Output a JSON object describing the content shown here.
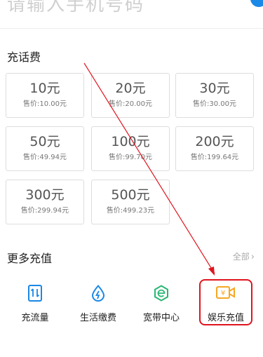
{
  "phone_input": {
    "placeholder": "请输入手机号码"
  },
  "recharge": {
    "title": "充话费",
    "options": [
      {
        "amount": "10元",
        "price": "售价:10.00元"
      },
      {
        "amount": "20元",
        "price": "售价:20.00元"
      },
      {
        "amount": "30元",
        "price": "售价:30.00元"
      },
      {
        "amount": "50元",
        "price": "售价:49.94元"
      },
      {
        "amount": "100元",
        "price": "售价:99.70元"
      },
      {
        "amount": "200元",
        "price": "售价:199.64元"
      },
      {
        "amount": "300元",
        "price": "售价:299.94元"
      },
      {
        "amount": "500元",
        "price": "售价:499.23元"
      }
    ]
  },
  "more": {
    "title": "更多充值",
    "all_label": "全部",
    "items": [
      {
        "label": "充流量",
        "icon": "data-traffic-icon"
      },
      {
        "label": "生活缴费",
        "icon": "bill-payment-icon"
      },
      {
        "label": "宽带中心",
        "icon": "broadband-icon"
      },
      {
        "label": "娱乐充值",
        "icon": "entertainment-recharge-icon"
      }
    ]
  },
  "colors": {
    "accent_blue": "#1a88e6",
    "accent_green": "#2bb673",
    "accent_orange": "#f5a623",
    "annotation_red": "#e0141e"
  }
}
